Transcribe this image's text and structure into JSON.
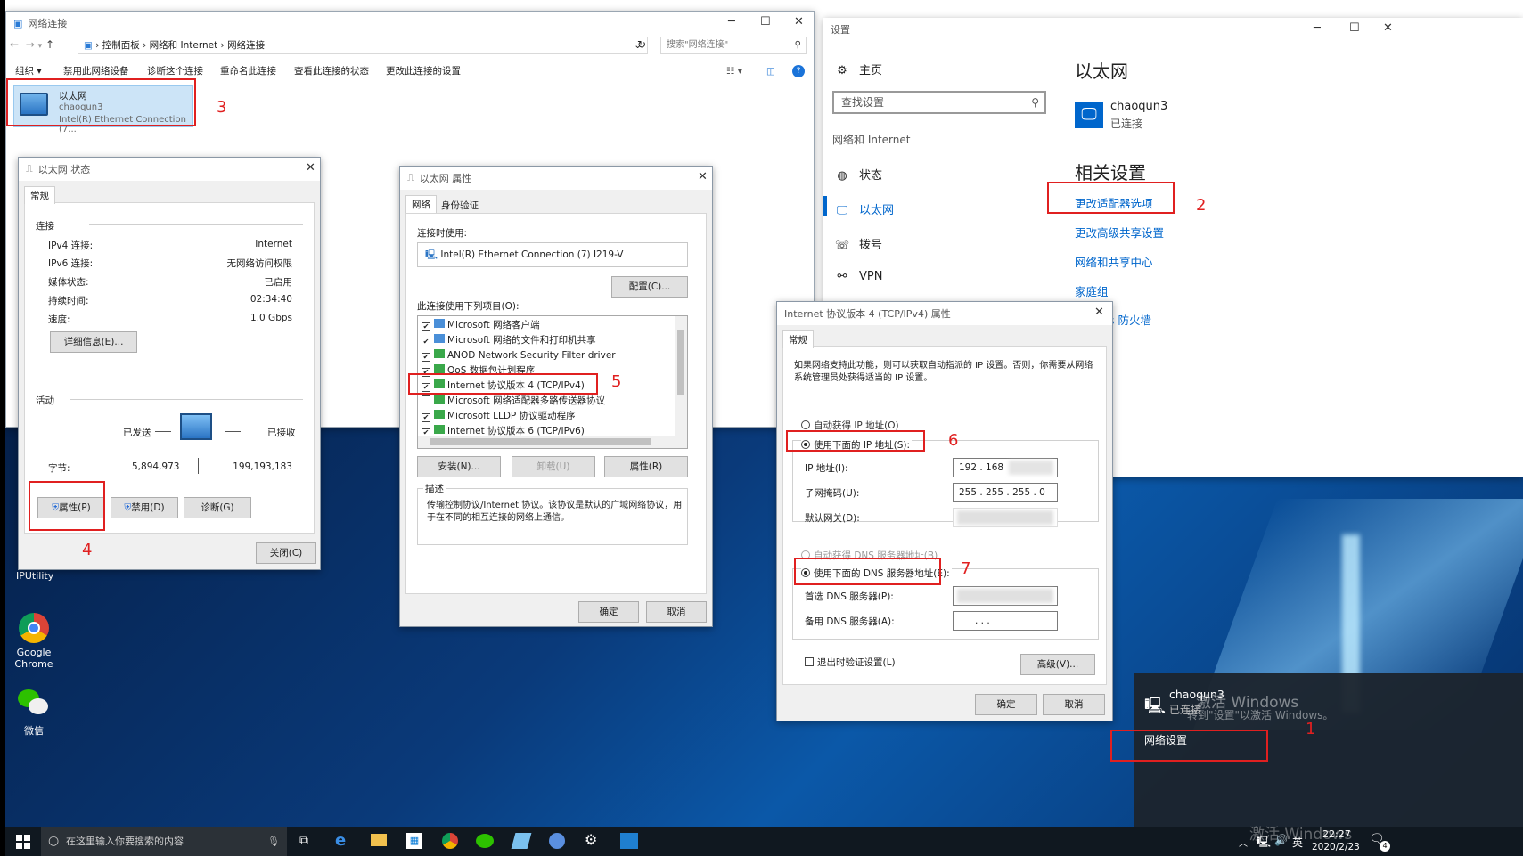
{
  "explorer": {
    "title": "网络连接",
    "breadcrumb": [
      "控制面板",
      "网络和 Internet",
      "网络连接"
    ],
    "search_placeholder": "搜索\"网络连接\"",
    "toolbar": [
      "组织 ▾",
      "禁用此网络设备",
      "诊断这个连接",
      "重命名此连接",
      "查看此连接的状态",
      "更改此连接的设置"
    ],
    "adapter": {
      "name": "以太网",
      "user": "chaoqun3",
      "device": "Intel(R) Ethernet Connection (7..."
    }
  },
  "status_dlg": {
    "title": "以太网 状态",
    "tab": "常规",
    "section_connection": "连接",
    "rows": [
      {
        "k": "IPv4 连接:",
        "v": "Internet"
      },
      {
        "k": "IPv6 连接:",
        "v": "无网络访问权限"
      },
      {
        "k": "媒体状态:",
        "v": "已启用"
      },
      {
        "k": "持续时间:",
        "v": "02:34:40"
      },
      {
        "k": "速度:",
        "v": "1.0 Gbps"
      }
    ],
    "details_btn": "详细信息(E)...",
    "section_activity": "活动",
    "sent": "已发送",
    "received": "已接收",
    "bytes_label": "字节:",
    "bytes_sent": "5,894,973",
    "bytes_recv": "199,193,183",
    "props_btn": "属性(P)",
    "disable_btn": "禁用(D)",
    "diag_btn": "诊断(G)",
    "close_btn": "关闭(C)"
  },
  "props_dlg": {
    "title": "以太网 属性",
    "tabs": [
      "网络",
      "身份验证"
    ],
    "connect_using": "连接时使用:",
    "adapter": "Intel(R) Ethernet Connection (7) I219-V",
    "config_btn": "配置(C)...",
    "items_label": "此连接使用下列项目(O):",
    "items": [
      {
        "label": "Microsoft 网络客户端",
        "checked": true
      },
      {
        "label": "Microsoft 网络的文件和打印机共享",
        "checked": true
      },
      {
        "label": "ANOD Network Security Filter driver",
        "checked": true
      },
      {
        "label": "QoS 数据包计划程序",
        "checked": true
      },
      {
        "label": "Internet 协议版本 4 (TCP/IPv4)",
        "checked": true
      },
      {
        "label": "Microsoft 网络适配器多路传送器协议",
        "checked": false
      },
      {
        "label": "Microsoft LLDP 协议驱动程序",
        "checked": true
      },
      {
        "label": "Internet 协议版本 6 (TCP/IPv6)",
        "checked": true
      }
    ],
    "install_btn": "安装(N)...",
    "uninstall_btn": "卸载(U)",
    "properties_btn": "属性(R)",
    "desc_title": "描述",
    "desc_text": "传输控制协议/Internet 协议。该协议是默认的广域网络协议，用于在不同的相互连接的网络上通信。",
    "ok": "确定",
    "cancel": "取消"
  },
  "ipv4_dlg": {
    "title": "Internet 协议版本 4 (TCP/IPv4) 属性",
    "tab": "常规",
    "intro": "如果网络支持此功能，则可以获取自动指派的 IP 设置。否则，你需要从网络系统管理员处获得适当的 IP 设置。",
    "auto_ip": "自动获得 IP 地址(O)",
    "manual_ip": "使用下面的 IP 地址(S):",
    "ip_label": "IP 地址(I):",
    "ip_value": "192 . 168",
    "mask_label": "子网掩码(U):",
    "mask_value": "255 . 255 . 255 .  0",
    "gw_label": "默认网关(D):",
    "auto_dns": "自动获得 DNS 服务器地址(B)",
    "manual_dns": "使用下面的 DNS 服务器地址(E):",
    "dns1_label": "首选 DNS 服务器(P):",
    "dns2_label": "备用 DNS 服务器(A):",
    "dns2_value": ".       .       .",
    "validate": "退出时验证设置(L)",
    "advanced_btn": "高级(V)...",
    "ok": "确定",
    "cancel": "取消"
  },
  "settings": {
    "title": "设置",
    "home": "主页",
    "search_placeholder": "查找设置",
    "category": "网络和 Internet",
    "nav": [
      "状态",
      "以太网",
      "拨号",
      "VPN"
    ],
    "heading": "以太网",
    "conn_name": "chaoqun3",
    "conn_status": "已连接",
    "related_heading": "相关设置",
    "links": [
      "更改适配器选项",
      "更改高级共享设置",
      "网络和共享中心",
      "家庭组",
      "s 防火墙"
    ]
  },
  "flyout": {
    "conn_name": "chaoqun3",
    "conn_status": "已连接",
    "net_settings": "网络设置",
    "watermark1": "激活 Windows",
    "watermark2": "转到\"设置\"以激活 Windows。"
  },
  "desktop_icons": [
    "IPUtility",
    "Google Chrome",
    "微信"
  ],
  "taskbar": {
    "search_placeholder": "在这里输入你要搜索的内容",
    "ime": "英",
    "time": "22:27",
    "date": "2020/2/23",
    "notif_count": "4",
    "edge_watermark": "激活 Windows"
  },
  "annotations": [
    "1",
    "2",
    "3",
    "4",
    "5",
    "6",
    "7"
  ],
  "colors": {
    "annotation": "#e02020",
    "link": "#0066cc",
    "taskbar": "#101820"
  }
}
